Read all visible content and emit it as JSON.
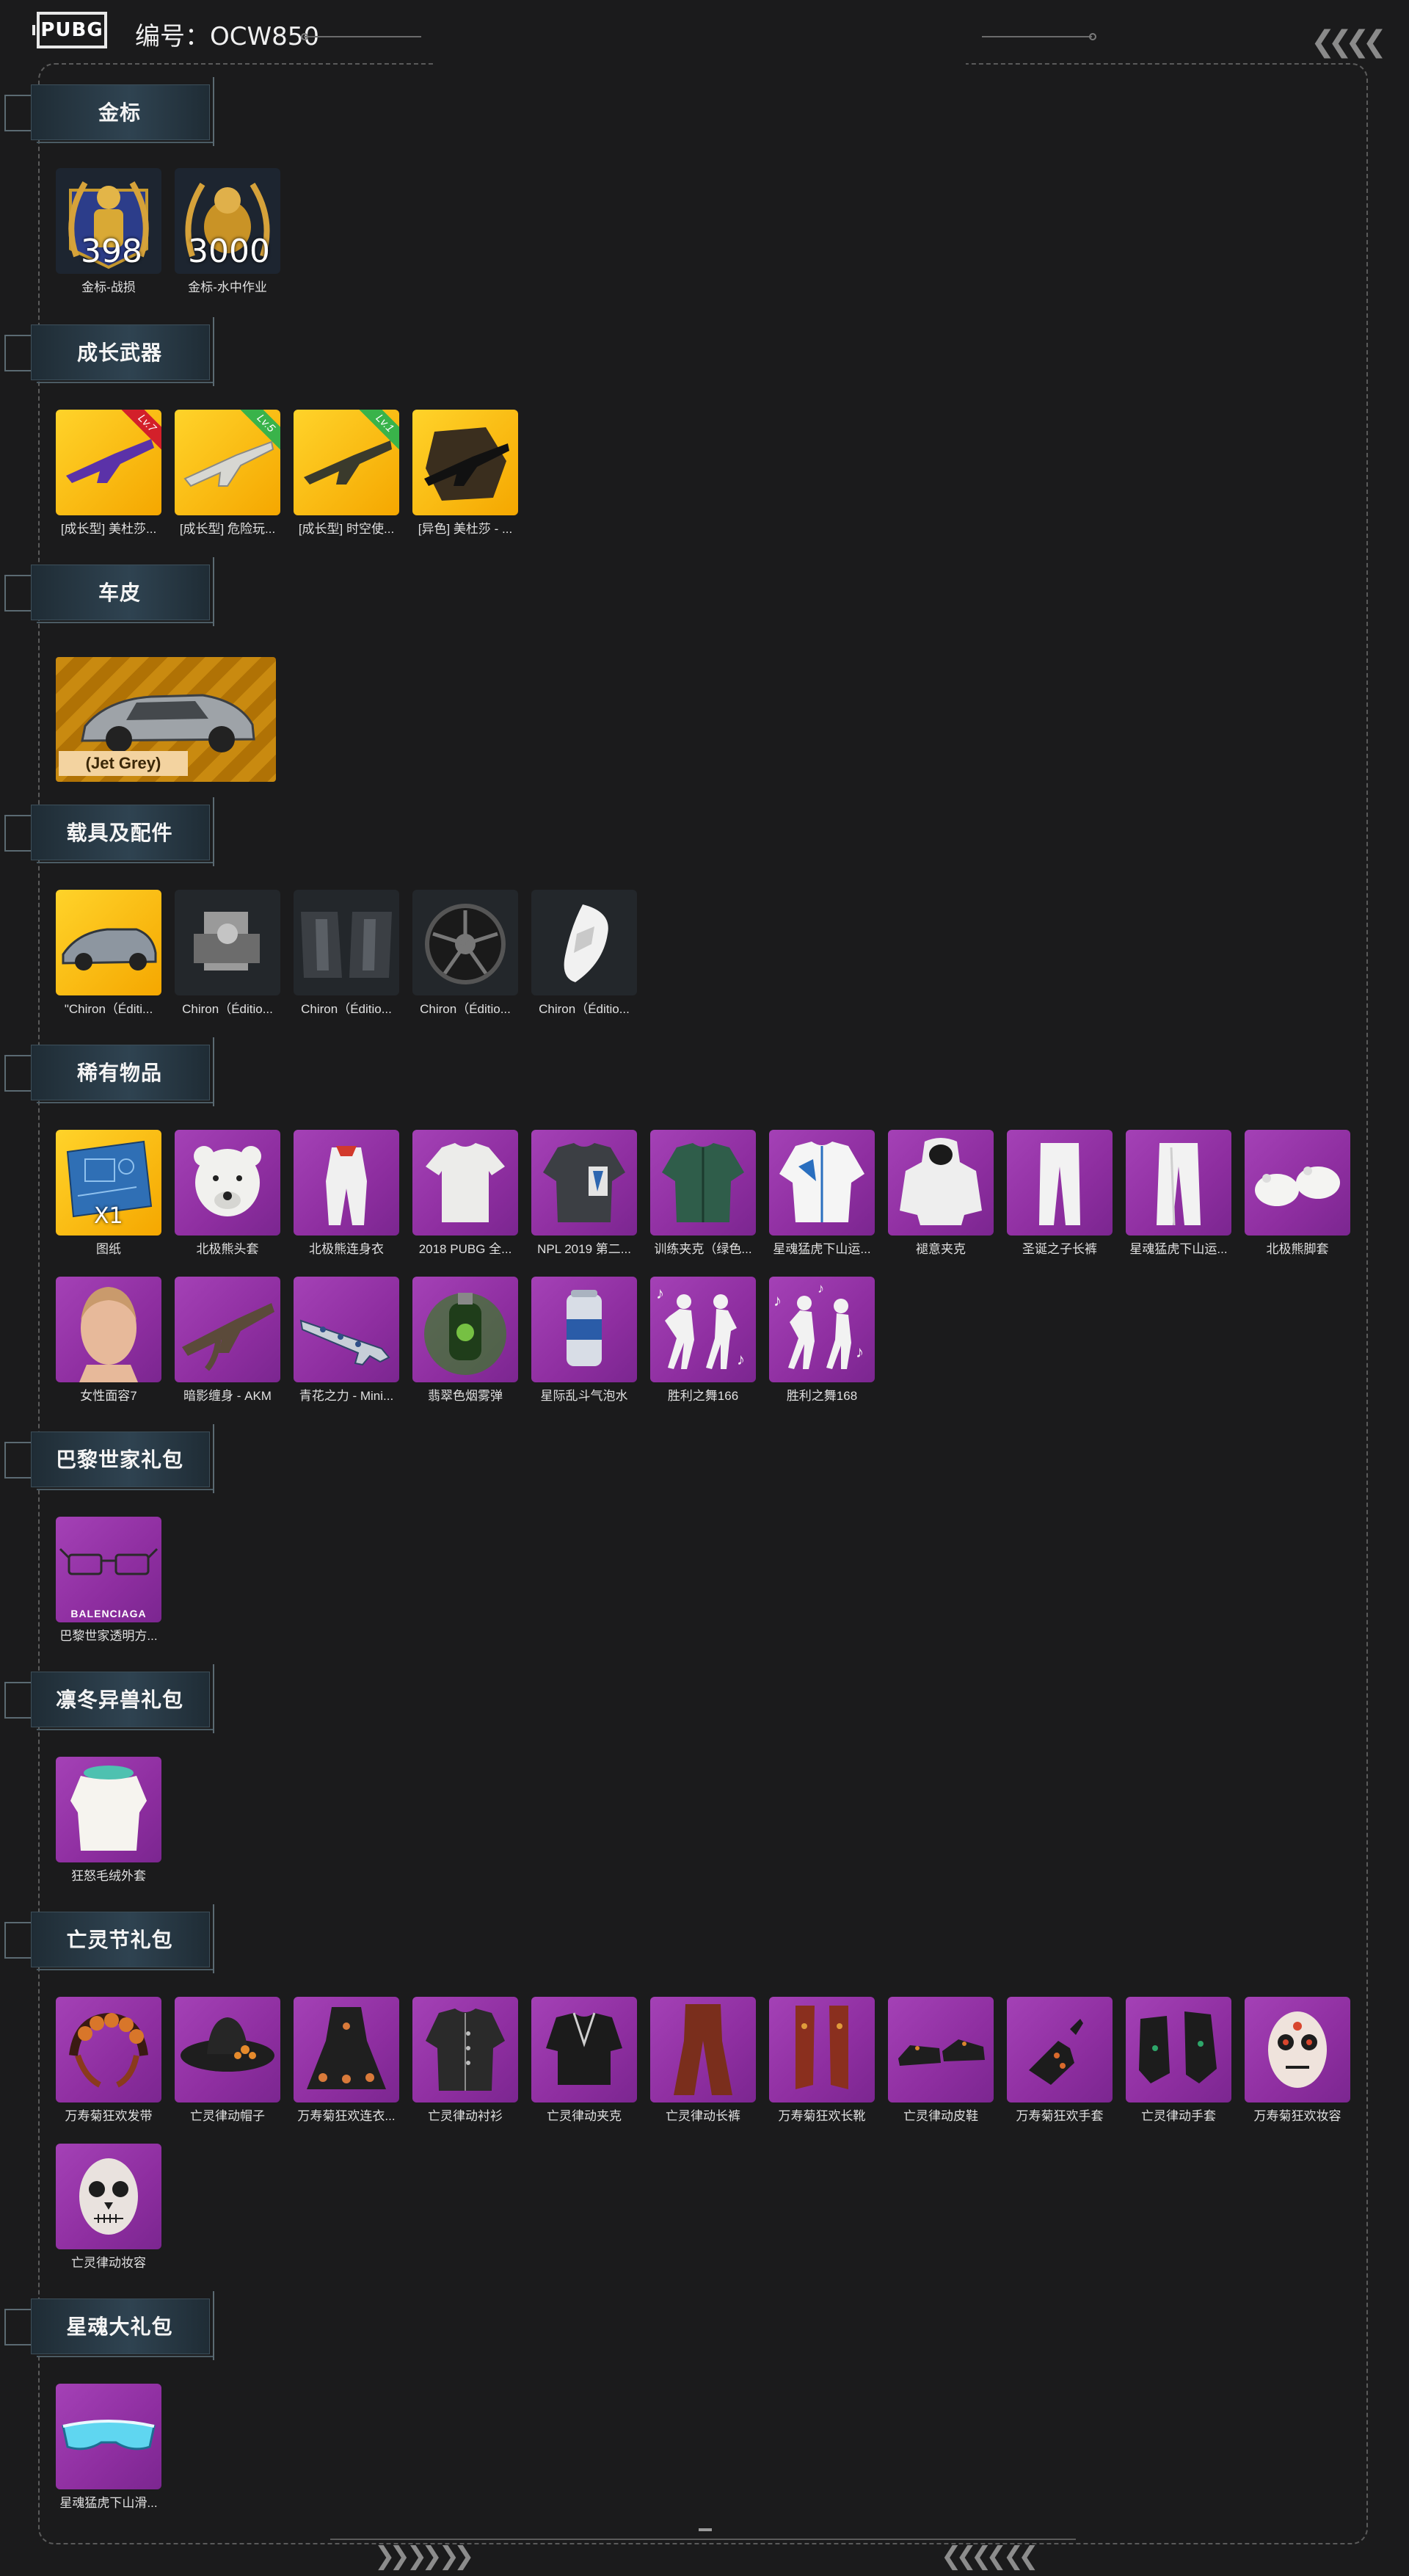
{
  "header": {
    "logo_text": "PUBG",
    "serial": "编号：OCW850"
  },
  "sections": {
    "gold": {
      "title": "金标",
      "items": [
        {
          "label": "金标-战损",
          "qty": "398"
        },
        {
          "label": "金标-水中作业",
          "qty": "3000"
        }
      ]
    },
    "weapons": {
      "title": "成长武器",
      "items": [
        {
          "label": "[成长型] 美杜莎...",
          "level": "Lv.7"
        },
        {
          "label": "[成长型] 危险玩...",
          "level": "Lv.5"
        },
        {
          "label": "[成长型] 时空使...",
          "level": "Lv.1"
        },
        {
          "label": "[异色] 美杜莎 - ..."
        }
      ]
    },
    "skins": {
      "title": "车皮",
      "items": [
        {
          "plate": "(Jet Grey)"
        }
      ]
    },
    "vehicle": {
      "title": "载具及配件",
      "items": [
        {
          "label": "\"Chiron（Éditi..."
        },
        {
          "label": "Chiron（Éditio..."
        },
        {
          "label": "Chiron（Éditio..."
        },
        {
          "label": "Chiron（Éditio..."
        },
        {
          "label": "Chiron（Éditio..."
        }
      ]
    },
    "rare": {
      "title": "稀有物品",
      "items": [
        {
          "label": "图纸",
          "qty": "X1"
        },
        {
          "label": "北极熊头套"
        },
        {
          "label": "北极熊连身衣"
        },
        {
          "label": "2018 PUBG 全..."
        },
        {
          "label": "NPL 2019 第二..."
        },
        {
          "label": "训练夹克（绿色..."
        },
        {
          "label": "星魂猛虎下山运..."
        },
        {
          "label": "褪意夹克"
        },
        {
          "label": "圣诞之子长裤"
        },
        {
          "label": "星魂猛虎下山运..."
        },
        {
          "label": "北极熊脚套"
        },
        {
          "label": "女性面容7"
        },
        {
          "label": "暗影缠身 - AKM"
        },
        {
          "label": "青花之力 - Mini..."
        },
        {
          "label": "翡翠色烟雾弹"
        },
        {
          "label": "星际乱斗气泡水"
        },
        {
          "label": "胜利之舞166"
        },
        {
          "label": "胜利之舞168"
        }
      ]
    },
    "balenciaga": {
      "title": "巴黎世家礼包",
      "items": [
        {
          "label": "巴黎世家透明方...",
          "brand": "BALENCIAGA"
        }
      ]
    },
    "winter": {
      "title": "凛冬异兽礼包",
      "items": [
        {
          "label": "狂怒毛绒外套"
        }
      ]
    },
    "dead": {
      "title": "亡灵节礼包",
      "items": [
        {
          "label": "万寿菊狂欢发带"
        },
        {
          "label": "亡灵律动帽子"
        },
        {
          "label": "万寿菊狂欢连衣..."
        },
        {
          "label": "亡灵律动衬衫"
        },
        {
          "label": "亡灵律动夹克"
        },
        {
          "label": "亡灵律动长裤"
        },
        {
          "label": "万寿菊狂欢长靴"
        },
        {
          "label": "亡灵律动皮鞋"
        },
        {
          "label": "万寿菊狂欢手套"
        },
        {
          "label": "亡灵律动手套"
        },
        {
          "label": "万寿菊狂欢妆容"
        },
        {
          "label": "亡灵律动妆容"
        }
      ]
    },
    "star": {
      "title": "星魂大礼包",
      "items": [
        {
          "label": "星魂猛虎下山滑..."
        }
      ]
    }
  },
  "colors": {
    "background": "#1b1b1c",
    "purple_tile": "#9b3aae",
    "gold_tile": "#fbbf17"
  }
}
